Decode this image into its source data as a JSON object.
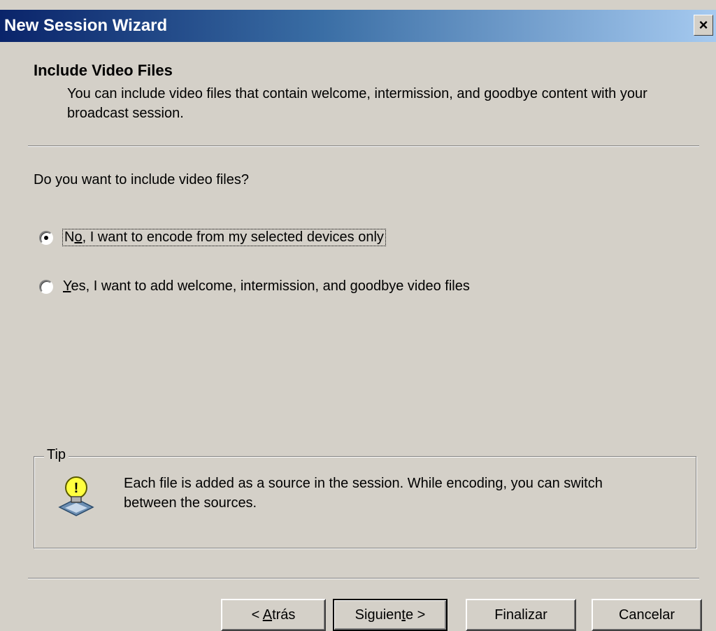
{
  "window": {
    "title": "New Session Wizard",
    "close_label": "×"
  },
  "header": {
    "title": "Include Video Files",
    "description": "You can include video files that contain welcome, intermission, and goodbye content with your broadcast session."
  },
  "question": "Do you want to include video files?",
  "options": [
    {
      "pre": "N",
      "accel": "o",
      "post": ", I want to encode from my selected devices only",
      "selected": true
    },
    {
      "pre": "",
      "accel": "Y",
      "post": "es, I want to add welcome, intermission, and goodbye video files",
      "selected": false
    }
  ],
  "tip": {
    "legend": "Tip",
    "icon": "lightbulb-icon",
    "text": "Each file is added as a source in the session. While encoding, you can switch between the sources."
  },
  "buttons": {
    "back": {
      "pre": "< ",
      "accel": "A",
      "post": "trás"
    },
    "next": {
      "pre": "Siguien",
      "accel": "t",
      "post": "e >"
    },
    "finish": {
      "label": "Finalizar"
    },
    "cancel": {
      "label": "Cancelar"
    }
  }
}
